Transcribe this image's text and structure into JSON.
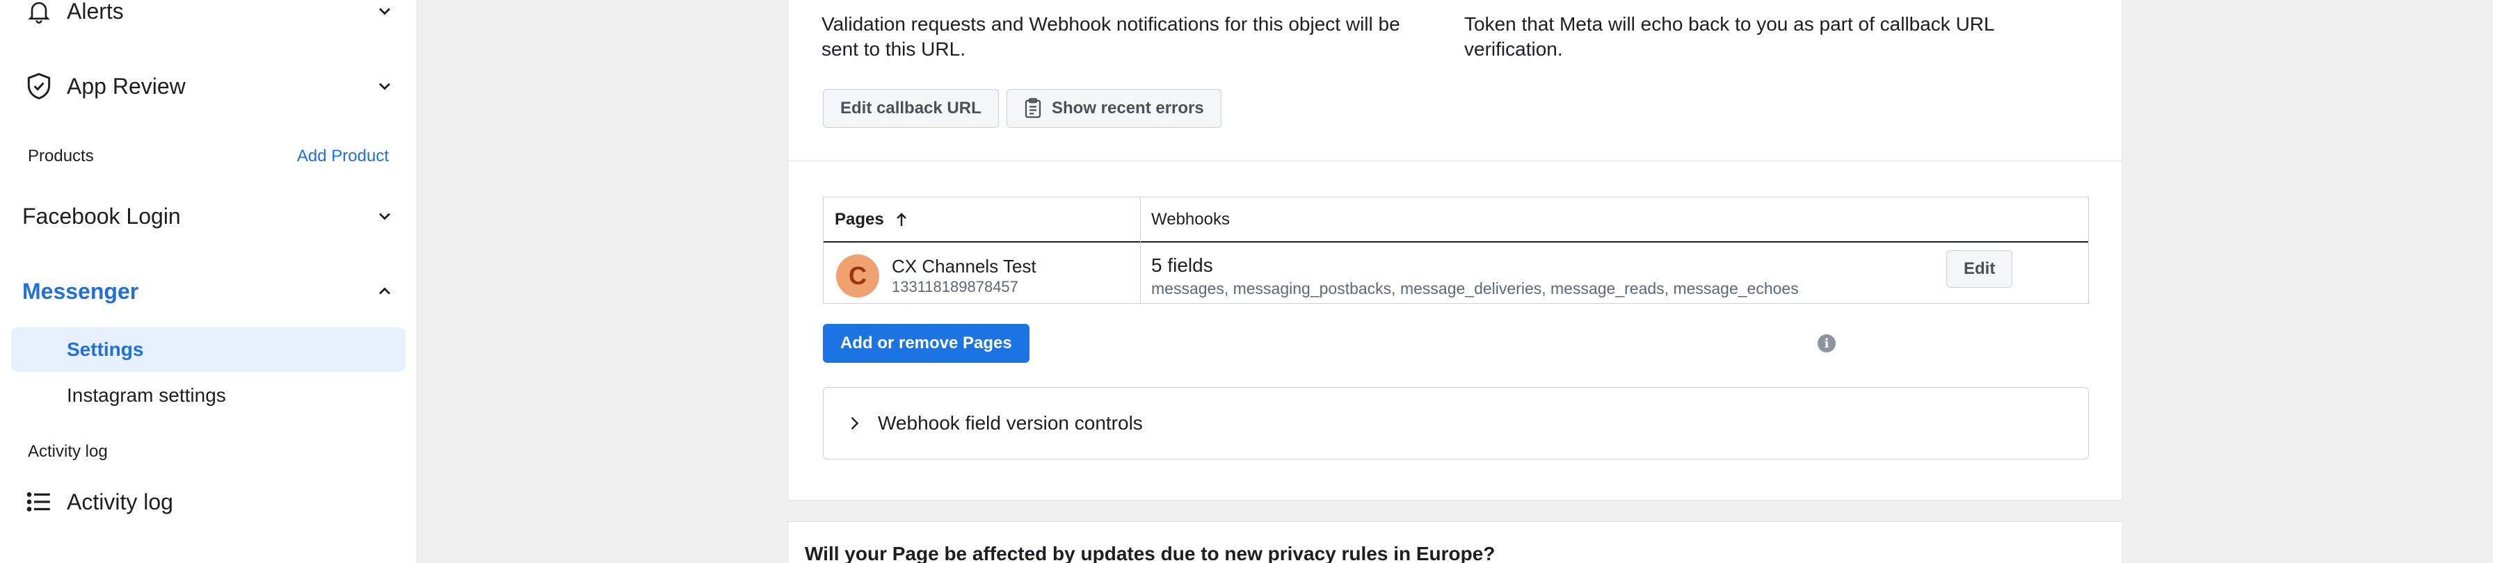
{
  "sidebar": {
    "alerts": "Alerts",
    "app_review": "App Review",
    "products_label": "Products",
    "add_product": "Add Product",
    "facebook_login": "Facebook Login",
    "messenger": "Messenger",
    "settings": "Settings",
    "instagram_settings": "Instagram settings",
    "activity_log_label": "Activity log",
    "activity_log": "Activity log"
  },
  "callback": {
    "url_desc": "Validation requests and Webhook notifications for this object will be sent to this URL.",
    "token_desc": "Token that Meta will echo back to you as part of callback URL verification.",
    "edit_button": "Edit callback URL",
    "errors_button": "Show recent errors"
  },
  "pages_table": {
    "col_pages": "Pages",
    "col_webhooks": "Webhooks",
    "rows": [
      {
        "avatar_letter": "C",
        "name": "CX Channels Test",
        "id": "133118189878457",
        "fields_count": "5 fields",
        "fields": "messages, messaging_postbacks, message_deliveries, message_reads, message_echoes",
        "edit": "Edit"
      }
    ]
  },
  "add_remove_pages": "Add or remove Pages",
  "info_glyph": "i",
  "accordion_label": "Webhook field version controls",
  "privacy_question": "Will your Page be affected by updates due to new privacy rules in Europe?",
  "colors": {
    "accent": "#216fdb",
    "primary_button": "#1b74e4",
    "active_bg": "#e7f0fd",
    "avatar": "#f0a170"
  }
}
